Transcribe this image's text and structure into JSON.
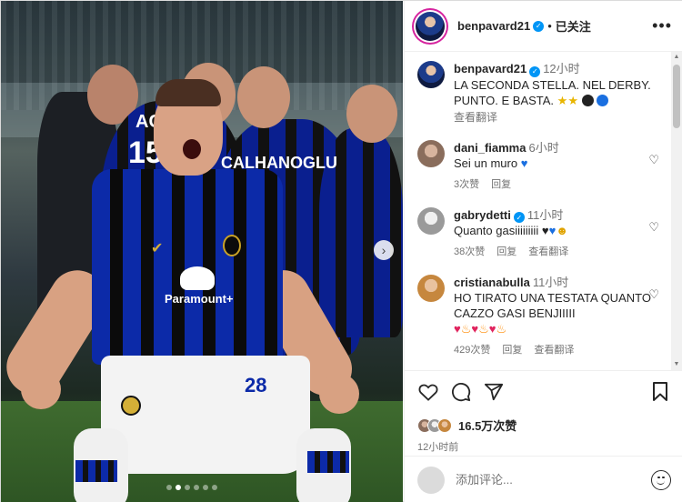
{
  "post": {
    "shirt_names": [
      "ACE",
      "CALHANOGLU"
    ],
    "shirt_number_partial": "15",
    "sponsor": "Paramount+",
    "shorts_number": "28",
    "carousel_dots": 6,
    "carousel_active_index": 1
  },
  "header": {
    "username": "benpavard21",
    "separator": "•",
    "follow_label": "已关注",
    "more_label": "•••"
  },
  "caption": {
    "username": "benpavard21",
    "time": "12小时",
    "text": "LA SECONDA STELLA. NEL DERBY. PUNTO. E BASTA.",
    "translate": "查看翻译"
  },
  "comments": [
    {
      "username": "dani_fiamma",
      "time": "6小时",
      "text": "Sei un muro",
      "likes": "3次赞",
      "reply": "回复",
      "verified": false
    },
    {
      "username": "gabrydetti",
      "time": "11小时",
      "text": "Quanto gasiiiiiiiii",
      "likes": "38次赞",
      "reply": "回复",
      "translate": "查看翻译",
      "verified": true
    },
    {
      "username": "cristianabulla",
      "time": "11小时",
      "text": "HO TIRATO UNA TESTATA QUANTO CAZZO GASI BENJIIIII",
      "likes": "429次赞",
      "reply": "回复",
      "translate": "查看翻译",
      "verified": false
    }
  ],
  "actions": {
    "likes": "16.5万次赞",
    "posted": "12小时前"
  },
  "add_comment": {
    "placeholder": "添加评论..."
  },
  "colors": {
    "verified": "#0095f6",
    "muted_text": "#737373",
    "story_ring": "#d6249f",
    "inter_blue": "#0c2aa8"
  },
  "icons": [
    "verified-badge-icon",
    "more-icon",
    "heart-icon",
    "comment-icon",
    "share-icon",
    "bookmark-icon",
    "emoji-icon",
    "next-arrow-icon"
  ]
}
